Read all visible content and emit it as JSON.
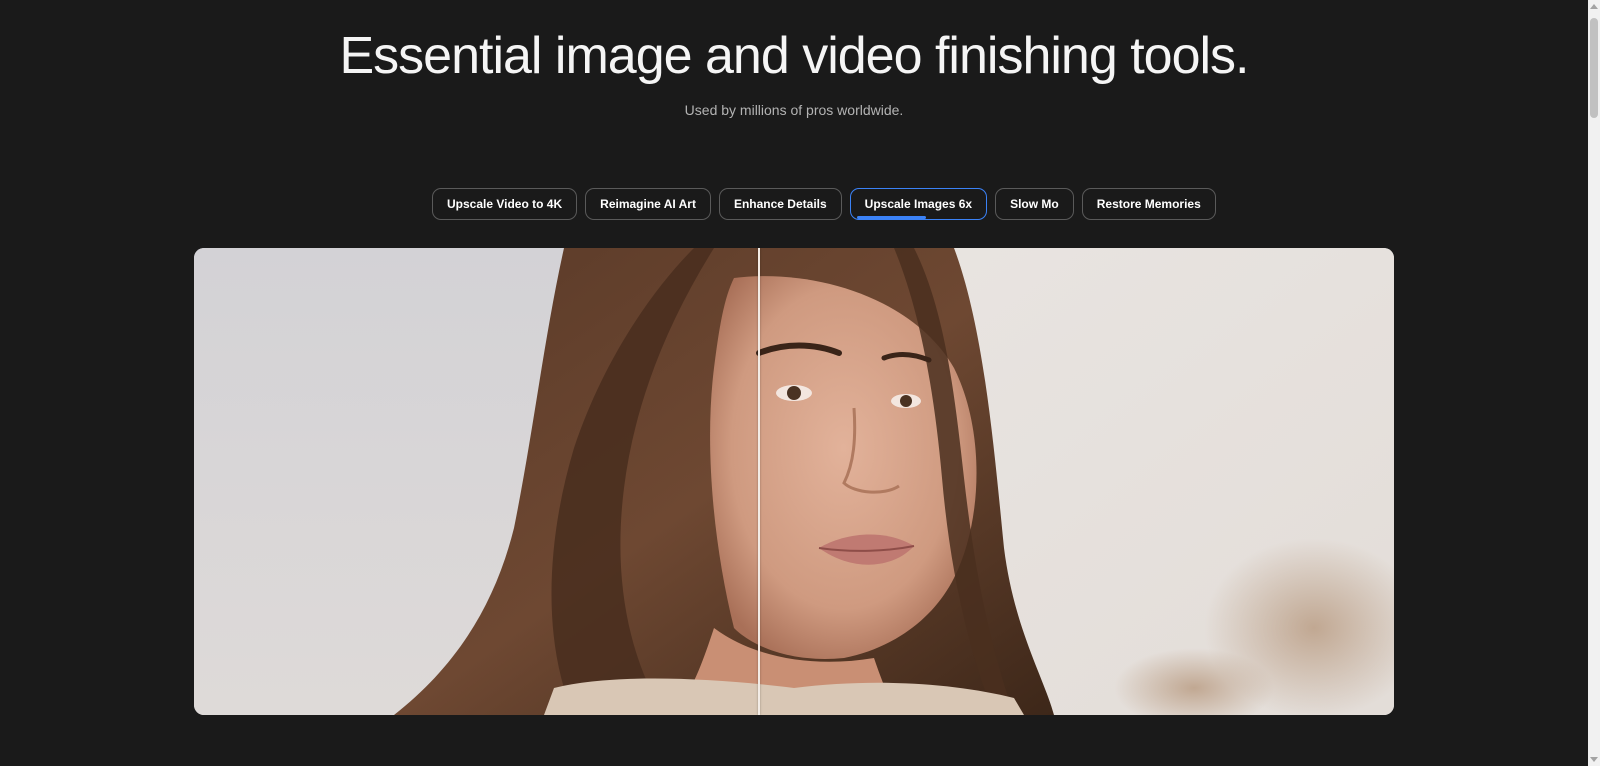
{
  "hero": {
    "title": "Essential image and video finishing tools.",
    "subtitle": "Used by millions of pros worldwide."
  },
  "tabs": [
    {
      "label": "Upscale Video to 4K",
      "active": false
    },
    {
      "label": "Reimagine AI Art",
      "active": false
    },
    {
      "label": "Enhance Details",
      "active": false
    },
    {
      "label": "Upscale Images 6x",
      "active": true,
      "progress": 0.55
    },
    {
      "label": "Slow Mo",
      "active": false
    },
    {
      "label": "Restore Memories",
      "active": false
    }
  ],
  "comparison": {
    "divider_position": 0.47
  },
  "colors": {
    "background": "#1a1a1a",
    "accent": "#3b82f6",
    "tab_border": "#5a5a5a"
  }
}
